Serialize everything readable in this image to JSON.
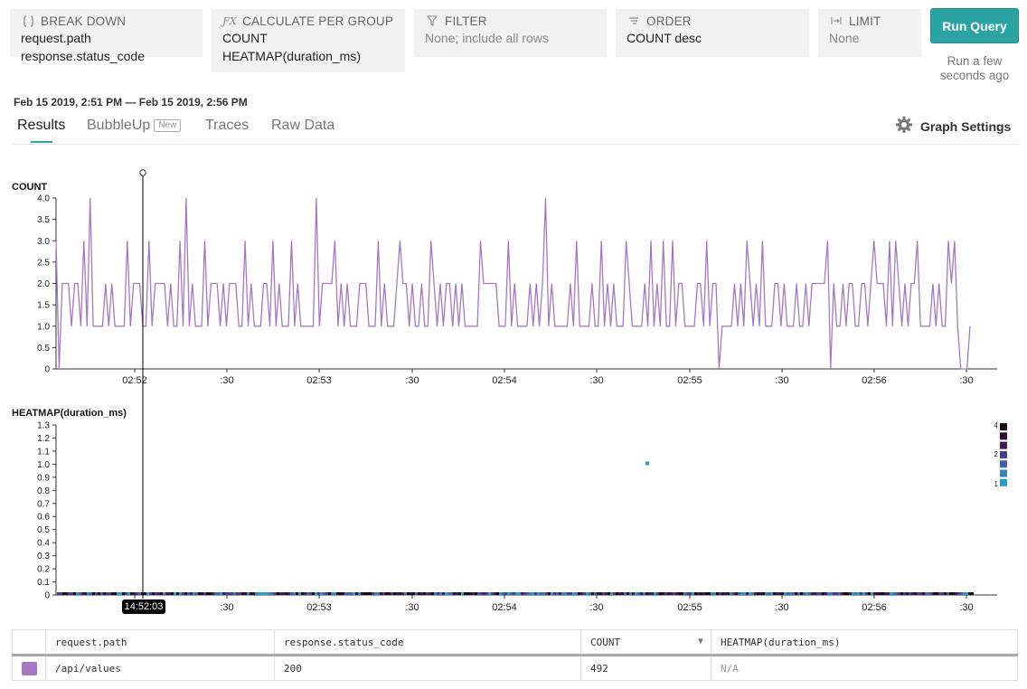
{
  "query": {
    "breakdown": {
      "icon": "braces-icon",
      "title": "BREAK DOWN",
      "items": [
        "request.path",
        "response.status_code"
      ]
    },
    "calculate": {
      "icon": "function-icon",
      "title": "CALCULATE PER GROUP",
      "items": [
        "COUNT",
        "HEATMAP(duration_ms)"
      ]
    },
    "filter": {
      "icon": "filter-icon",
      "title": "FILTER",
      "value": "None; include all rows"
    },
    "order": {
      "icon": "sort-icon",
      "title": "ORDER",
      "value": "COUNT desc"
    },
    "limit": {
      "icon": "limit-icon",
      "title": "LIMIT",
      "value": "None"
    },
    "run_label": "Run Query",
    "run_status": "Run a few seconds ago"
  },
  "time_range": "Feb 15 2019, 2:51 PM — Feb 15 2019, 2:56 PM",
  "tabs": [
    {
      "label": "Results",
      "active": true
    },
    {
      "label": "BubbleUp",
      "badge": "New"
    },
    {
      "label": "Traces"
    },
    {
      "label": "Raw Data"
    }
  ],
  "graph_settings_label": "Graph Settings",
  "graph_settings_icon": "gear-icon",
  "cursor_time": "14:52:03",
  "colors": {
    "accent": "#2ca3a3",
    "series": "#a678c2"
  },
  "chart_data": [
    {
      "type": "line",
      "title": "COUNT",
      "x_range": [
        "02:51:15",
        "02:56:30"
      ],
      "x_ticks": [
        "02:52",
        ":30",
        "02:53",
        ":30",
        "02:54",
        ":30",
        "02:55",
        ":30",
        "02:56",
        ":30"
      ],
      "y_ticks": [
        "4.0",
        "3.5",
        "3.0",
        "2.5",
        "2.0",
        "1.5",
        "1.0",
        "0.5",
        "0"
      ],
      "ylim": [
        0,
        4
      ],
      "series": [
        {
          "values": [
            3,
            0,
            2,
            2,
            2,
            1,
            2,
            2,
            1,
            3,
            1,
            4,
            1,
            1,
            1,
            1,
            2,
            1,
            2,
            1,
            1,
            1,
            1,
            3,
            1,
            2,
            2,
            2,
            1,
            1,
            3,
            1,
            2,
            2,
            2,
            2,
            1,
            2,
            1,
            1,
            3,
            1,
            4,
            1,
            2,
            1,
            1,
            1,
            3,
            1,
            2,
            2,
            2,
            1,
            2,
            1,
            2,
            2,
            2,
            1,
            1,
            3,
            1,
            2,
            1,
            1,
            1,
            2,
            2,
            1,
            3,
            1,
            2,
            1,
            1,
            1,
            3,
            1,
            2,
            1,
            1,
            1,
            1,
            1,
            4,
            1,
            2,
            2,
            2,
            2,
            3,
            1,
            2,
            1,
            2,
            1,
            1,
            1,
            2,
            2,
            2,
            1,
            1,
            1,
            3,
            1,
            2,
            1,
            1,
            1,
            2,
            3,
            2,
            2,
            1,
            2,
            1,
            1,
            2,
            1,
            1,
            3,
            2,
            1,
            2,
            1,
            2,
            2,
            1,
            2,
            1,
            2,
            1,
            1,
            1,
            1,
            1,
            3,
            2,
            2,
            2,
            2,
            2,
            1,
            1,
            1,
            3,
            1,
            2,
            1,
            1,
            1,
            1,
            2,
            1,
            2,
            1,
            2,
            4,
            1,
            2,
            1,
            1,
            1,
            1,
            1,
            2,
            1,
            3,
            1,
            1,
            1,
            1,
            2,
            1,
            1,
            3,
            1,
            2,
            1,
            2,
            1,
            1,
            1,
            3,
            2,
            1,
            1,
            1,
            1,
            2,
            1,
            3,
            1,
            2,
            1,
            3,
            1,
            1,
            3,
            1,
            2,
            2,
            1,
            1,
            1,
            1,
            2,
            2,
            1,
            3,
            1,
            2,
            2,
            0,
            1,
            1,
            1,
            1,
            2,
            1,
            2,
            1,
            3,
            2,
            1,
            2,
            1,
            3,
            1,
            1,
            1,
            2,
            2,
            1,
            2,
            1,
            1,
            1,
            2,
            1,
            1,
            2,
            1,
            2,
            2,
            2,
            2,
            2,
            3,
            0,
            2,
            1,
            1,
            2,
            1,
            2,
            2,
            1,
            1,
            2,
            2,
            1,
            2,
            3,
            2,
            2,
            2,
            1,
            3,
            1,
            3,
            2,
            1,
            2,
            1,
            2,
            2,
            3,
            1,
            1,
            1,
            1,
            2,
            1,
            2,
            1,
            1,
            3,
            2,
            3,
            1,
            0,
            0,
            0,
            1
          ]
        }
      ]
    },
    {
      "type": "heatmap",
      "title": "HEATMAP(duration_ms)",
      "y_ticks": [
        "1.3",
        "1.2",
        "1.1",
        "1.0",
        "0.9",
        "0.8",
        "0.7",
        "0.6",
        "0.5",
        "0.4",
        "0.3",
        "0.2",
        "0.1",
        "0"
      ],
      "ylim": [
        0,
        1.3
      ],
      "x_ticks": [
        "02:52",
        ":30",
        "02:53",
        ":30",
        "02:54",
        ":30",
        "02:55",
        ":30",
        "02:56",
        ":30"
      ],
      "legend_labels": [
        "4",
        "2",
        "1"
      ],
      "legend_colors": [
        "#1a0a16",
        "#2a1030",
        "#3a1d5a",
        "#4b3a8c",
        "#3f63a6",
        "#3780b5",
        "#2a9cc4"
      ],
      "outlier": {
        "time": "02:55:00",
        "value": 1.0
      }
    }
  ],
  "table": {
    "headers": [
      "request.path",
      "response.status_code",
      "COUNT",
      "HEATMAP(duration_ms)"
    ],
    "rows": [
      {
        "path": "/api/values",
        "status": "200",
        "count": "492",
        "heatmap": "N/A"
      }
    ]
  }
}
